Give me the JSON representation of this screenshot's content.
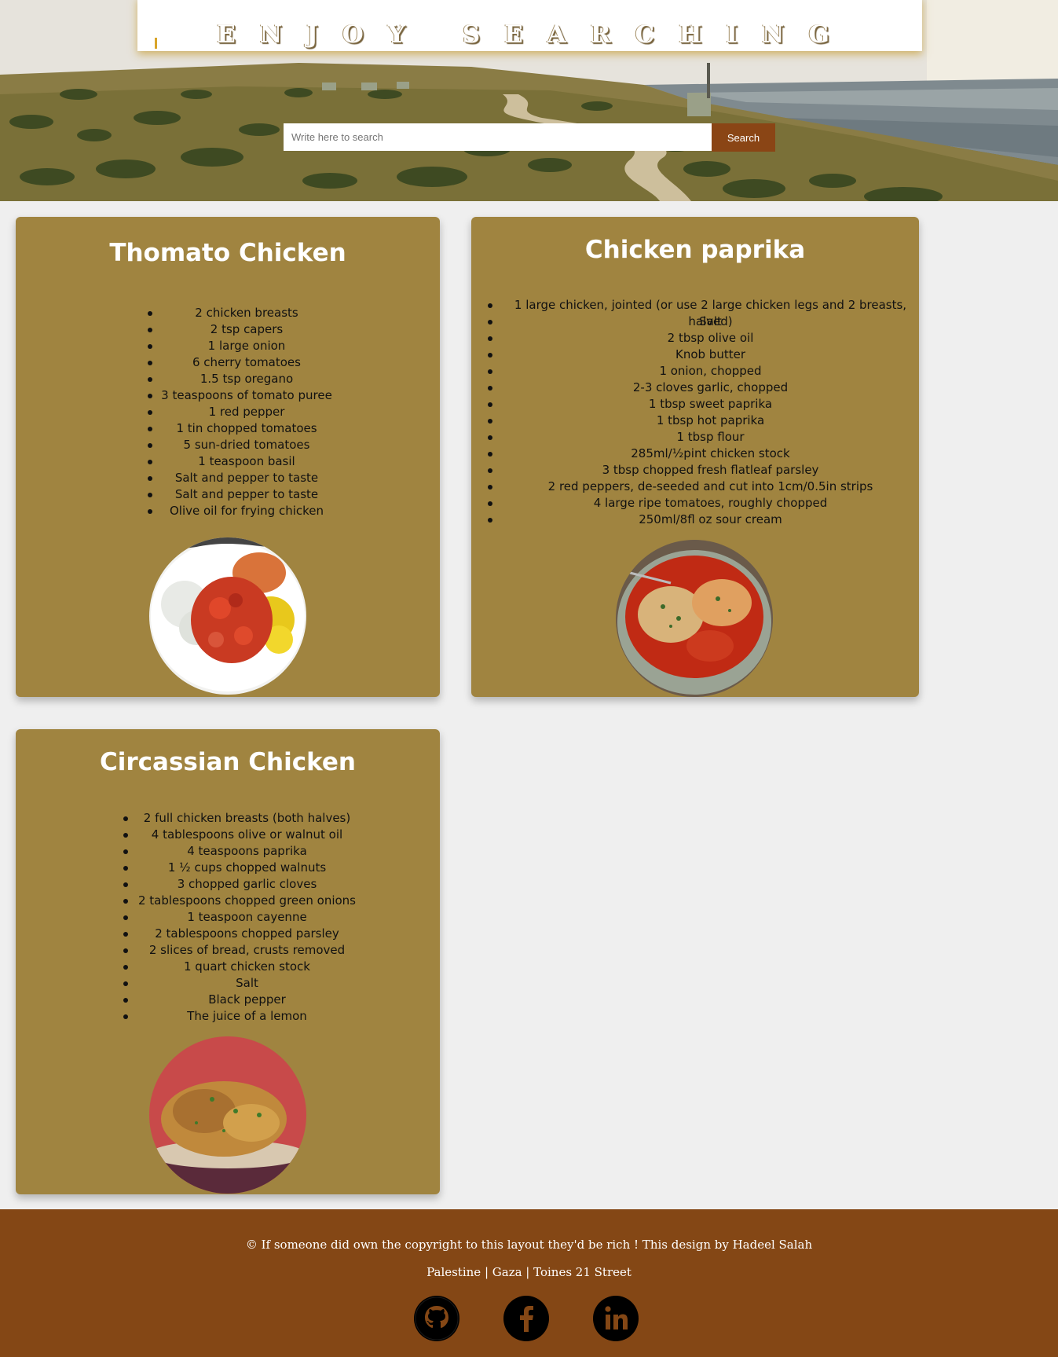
{
  "header": {
    "banner_title": "ENJOY SEARCHING",
    "search": {
      "placeholder": "Write here to search",
      "value": "",
      "button_label": "Search"
    }
  },
  "recipes": [
    {
      "title": "Thomato Chicken",
      "ingredients": [
        "2 chicken breasts",
        "2 tsp capers",
        "1 large onion",
        "6 cherry tomatoes",
        "1.5 tsp oregano",
        "3 teaspoons of tomato puree",
        "1 red pepper",
        "1 tin chopped tomatoes",
        "5 sun-dried tomatoes",
        "1 teaspoon basil",
        "Salt and pepper to taste",
        "Salt and pepper to taste",
        "Olive oil for frying chicken"
      ]
    },
    {
      "title": "Chicken paprika",
      "ingredients": [
        "1 large chicken, jointed (or use 2 large chicken legs and 2 breasts, halved)",
        "Salt",
        "2 tbsp olive oil",
        "Knob butter",
        "1 onion, chopped",
        "2-3 cloves garlic, chopped",
        "1 tbsp sweet paprika",
        "1 tbsp hot paprika",
        "1 tbsp flour",
        "285ml/½pint chicken stock",
        "3 tbsp chopped fresh flatleaf parsley",
        "2 red peppers, de-seeded and cut into 1cm/0.5in strips",
        "4 large ripe tomatoes, roughly chopped",
        "250ml/8fl oz sour cream"
      ]
    },
    {
      "title": "Circassian Chicken",
      "ingredients": [
        "2 full chicken breasts (both halves)",
        "4 tablespoons olive or walnut oil",
        "4 teaspoons paprika",
        "1 ½ cups chopped walnuts",
        "3 chopped garlic cloves",
        "2 tablespoons chopped green onions",
        "1 teaspoon cayenne",
        "2 tablespoons chopped parsley",
        "2 slices of bread, crusts removed",
        "1 quart chicken stock",
        "Salt",
        "Black pepper",
        "The juice of a lemon"
      ]
    }
  ],
  "footer": {
    "copyright": "© If someone did own the copyright to this layout they'd be rich ! This design by Hadeel Salah",
    "address": "Palestine | Gaza | Toines 21 Street",
    "social": [
      "github-icon",
      "facebook-icon",
      "linkedin-icon"
    ]
  },
  "colors": {
    "card": "#a08440",
    "search_button": "#8a4515",
    "footer": "#844715",
    "background": "#efefef"
  }
}
